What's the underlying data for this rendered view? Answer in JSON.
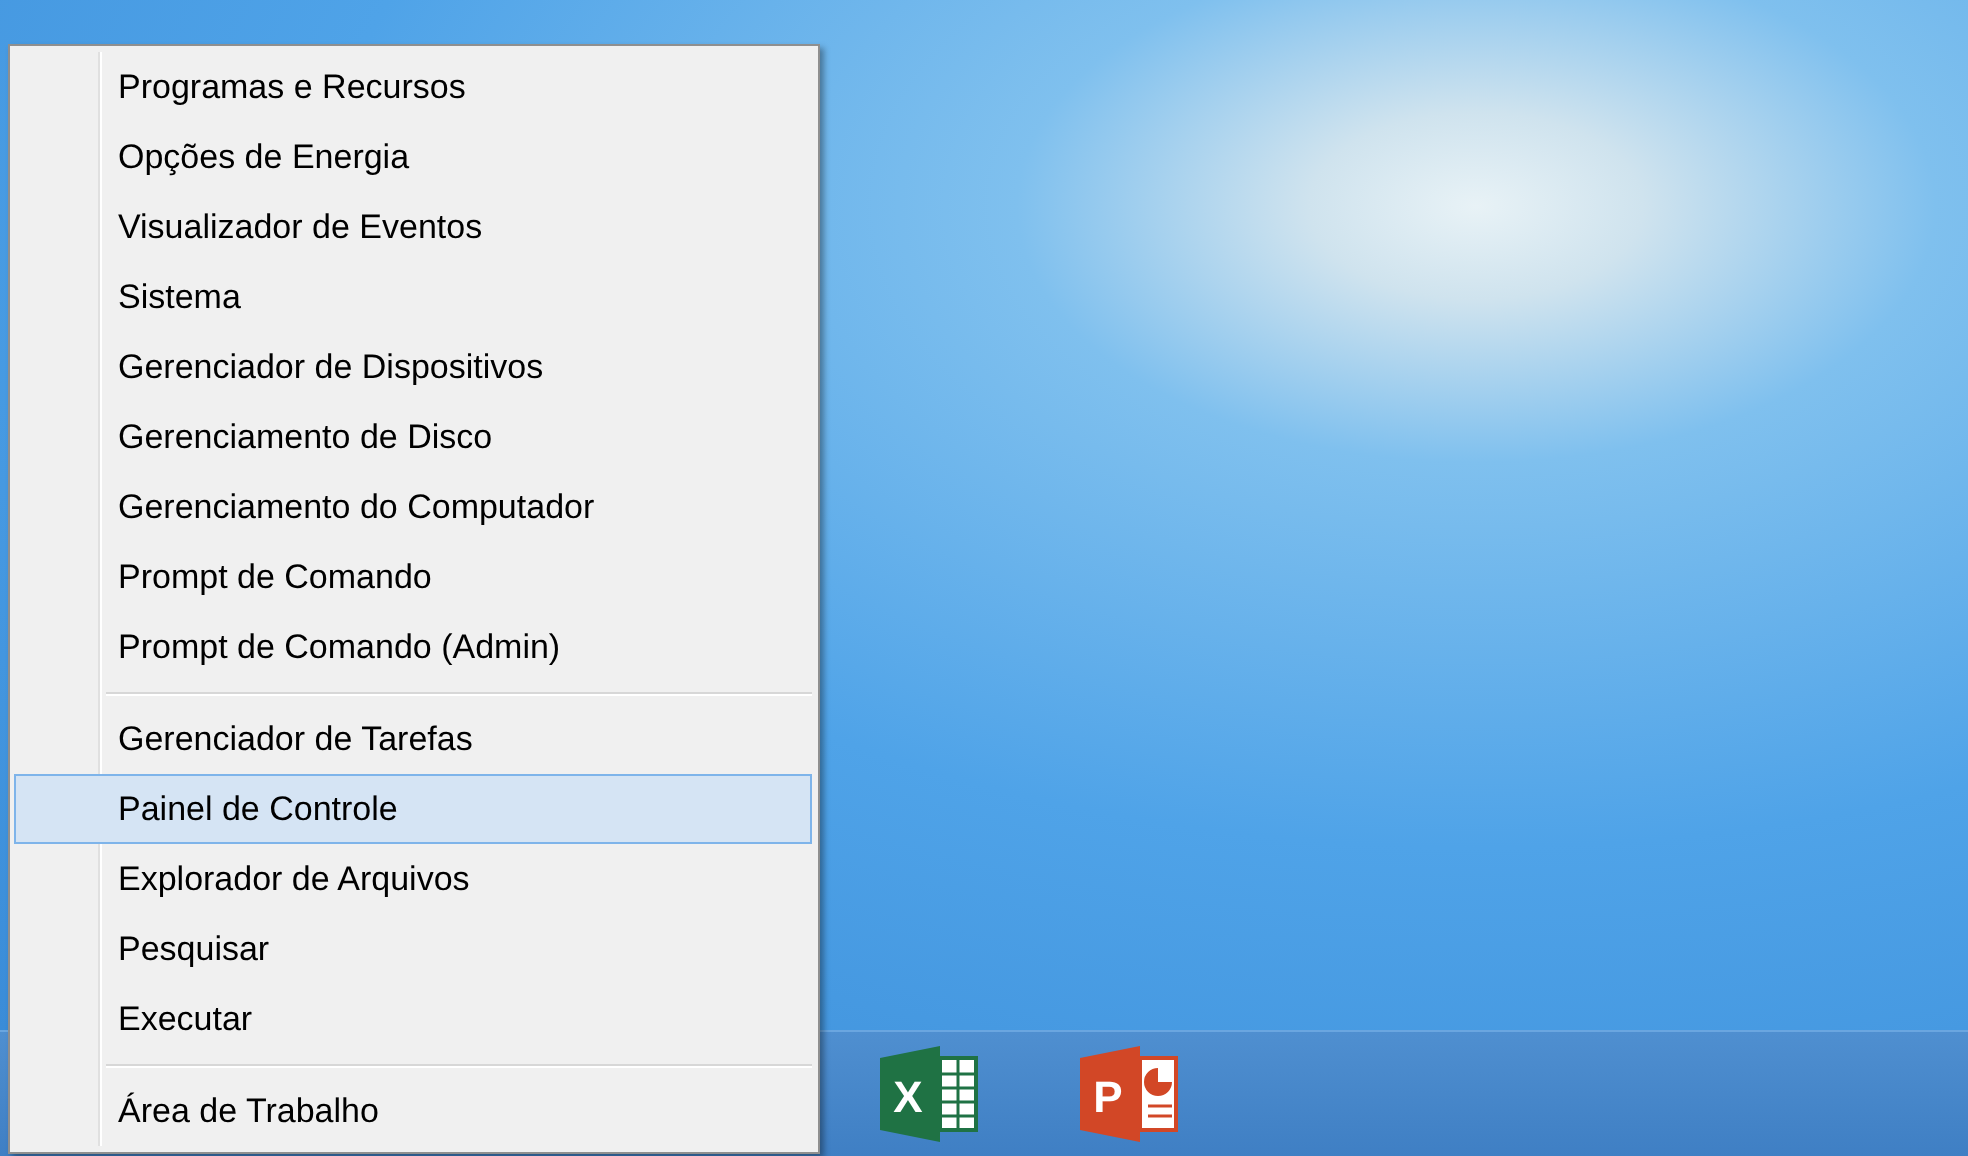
{
  "menu": {
    "groups": [
      {
        "items": [
          {
            "label": "Programas e Recursos",
            "selected": false
          },
          {
            "label": "Opções de Energia",
            "selected": false
          },
          {
            "label": "Visualizador de Eventos",
            "selected": false
          },
          {
            "label": "Sistema",
            "selected": false
          },
          {
            "label": "Gerenciador de Dispositivos",
            "selected": false
          },
          {
            "label": "Gerenciamento de Disco",
            "selected": false
          },
          {
            "label": "Gerenciamento do Computador",
            "selected": false
          },
          {
            "label": "Prompt de Comando",
            "selected": false
          },
          {
            "label": "Prompt de Comando (Admin)",
            "selected": false
          }
        ]
      },
      {
        "items": [
          {
            "label": "Gerenciador de Tarefas",
            "selected": false
          },
          {
            "label": "Painel de Controle",
            "selected": true
          },
          {
            "label": "Explorador de Arquivos",
            "selected": false
          },
          {
            "label": "Pesquisar",
            "selected": false
          },
          {
            "label": "Executar",
            "selected": false
          }
        ]
      },
      {
        "items": [
          {
            "label": "Área de Trabalho",
            "selected": false
          }
        ]
      }
    ]
  },
  "taskbar": {
    "apps": [
      {
        "kind": "spreadsheet",
        "letter": "X"
      },
      {
        "kind": "presentation",
        "letter": "P"
      }
    ]
  }
}
